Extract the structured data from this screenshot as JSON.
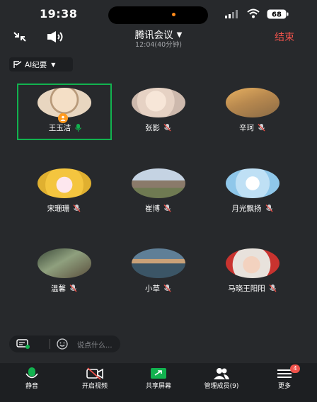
{
  "status_bar": {
    "time": "19:38",
    "battery": "68"
  },
  "header": {
    "title": "腾讯会议",
    "duration": "12:04(40分钟)",
    "end_label": "结束"
  },
  "ai_minutes": {
    "label": "AI纪要"
  },
  "participants": [
    {
      "name": "王玉洁",
      "mic": "on",
      "host": true
    },
    {
      "name": "张影",
      "mic": "muted"
    },
    {
      "name": "辛珂",
      "mic": "muted"
    },
    {
      "name": "宋珊珊",
      "mic": "muted"
    },
    {
      "name": "崔博",
      "mic": "muted"
    },
    {
      "name": "月光飘扬",
      "mic": "muted"
    },
    {
      "name": "温馨",
      "mic": "muted"
    },
    {
      "name": "小草",
      "mic": "muted"
    },
    {
      "name": "马晓王阳阳",
      "mic": "muted"
    }
  ],
  "comment": {
    "placeholder": "说点什么..."
  },
  "toolbar": {
    "mute_label": "静音",
    "video_label": "开启视频",
    "share_label": "共享屏幕",
    "members_label": "管理成员(9)",
    "more_label": "更多",
    "more_badge": "4"
  },
  "colors": {
    "background": "#27292c",
    "bar": "#1d1f22",
    "accent_green": "#12b24f",
    "danger_red": "#f0524b"
  }
}
